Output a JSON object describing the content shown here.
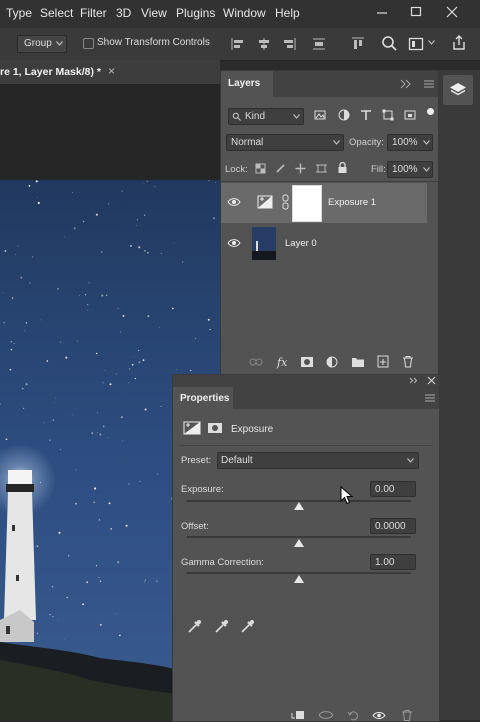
{
  "menubar": {
    "items": [
      "Type",
      "Select",
      "Filter",
      "3D",
      "View",
      "Plugins",
      "Window",
      "Help"
    ]
  },
  "options_bar": {
    "group_select": "Group",
    "show_transform_controls": "Show Transform Controls"
  },
  "document_tab": {
    "title": "re 1, Layer Mask/8) *",
    "close": "×"
  },
  "layers_panel": {
    "title": "Layers",
    "filter_kind": "Kind",
    "blend_mode": "Normal",
    "opacity_label": "Opacity:",
    "opacity_value": "100%",
    "lock_label": "Lock:",
    "fill_label": "Fill:",
    "fill_value": "100%",
    "layers": [
      {
        "name": "Exposure 1"
      },
      {
        "name": "Layer 0"
      }
    ]
  },
  "properties_panel": {
    "title": "Properties",
    "adjustment_name": "Exposure",
    "preset_label": "Preset:",
    "preset_value": "Default",
    "exposure_label": "Exposure:",
    "exposure_value": "0.00",
    "offset_label": "Offset:",
    "offset_value": "0.0000",
    "gamma_label": "Gamma Correction:",
    "gamma_value": "1.00"
  },
  "colors": {
    "menubar_bg": "#323232",
    "panel_bg": "#535353",
    "selected_layer_bg": "#6a6a6a",
    "canvas_sky": "#2b4878"
  }
}
